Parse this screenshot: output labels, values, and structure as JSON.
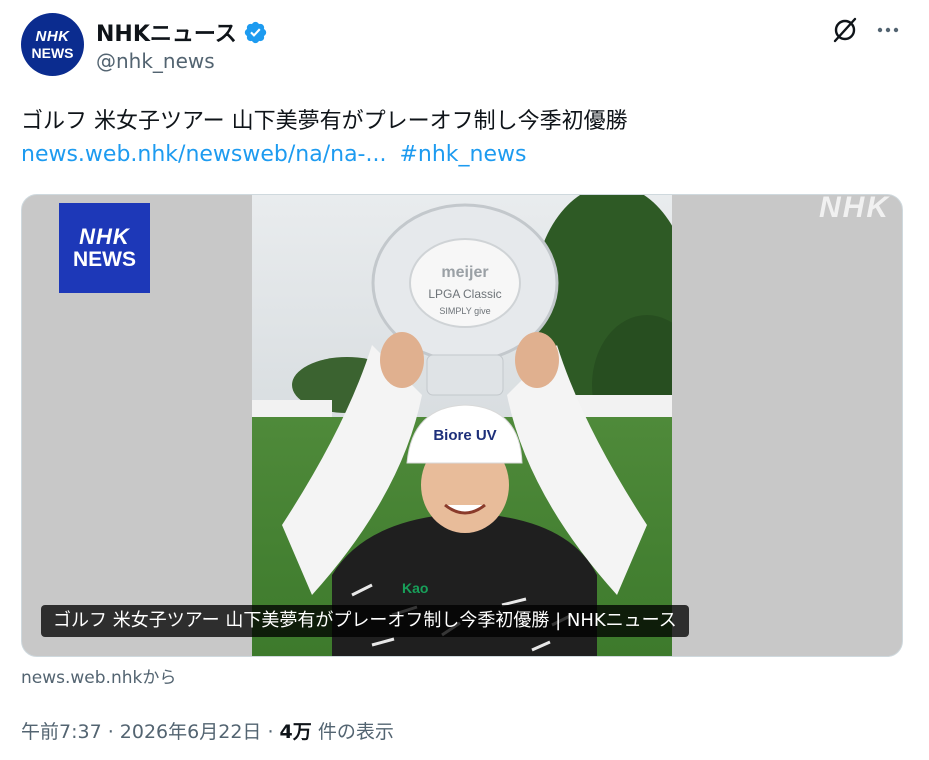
{
  "account": {
    "display_name": "NHKニュース",
    "handle": "@nhk_news",
    "avatar_line1": "NHK",
    "avatar_line2": "NEWS",
    "verified_color": "#1d9bf0"
  },
  "actions": {
    "grok_icon": "grok-icon",
    "more_icon": "more-icon"
  },
  "tweet": {
    "text": "ゴルフ 米女子ツアー 山下美夢有がプレーオフ制し今季初優勝",
    "link": "news.web.nhk/newsweb/na/na-...",
    "hashtag": "#nhk_news"
  },
  "card": {
    "logo_line1": "NHK",
    "logo_line2": "NEWS",
    "watermark": "NHK",
    "caption": "ゴルフ 米女子ツアー 山下美夢有がプレーオフ制し今季初優勝 | NHKニュース",
    "source": "news.web.nhkから",
    "trophy_text": "meijer",
    "trophy_text2": "LPGA Classic",
    "trophy_text3": "SIMPLY give",
    "cap_text": "Biore UV",
    "shirt_text": "Kao"
  },
  "meta": {
    "time": "午前7:37",
    "separator1": " · ",
    "date": "2026年6月22日",
    "separator2": " · ",
    "views": "4万",
    "views_label": " 件の表示"
  },
  "colors": {
    "link": "#1d9bf0",
    "secondary_text": "#536471",
    "nhk_blue": "#1d38b8"
  }
}
